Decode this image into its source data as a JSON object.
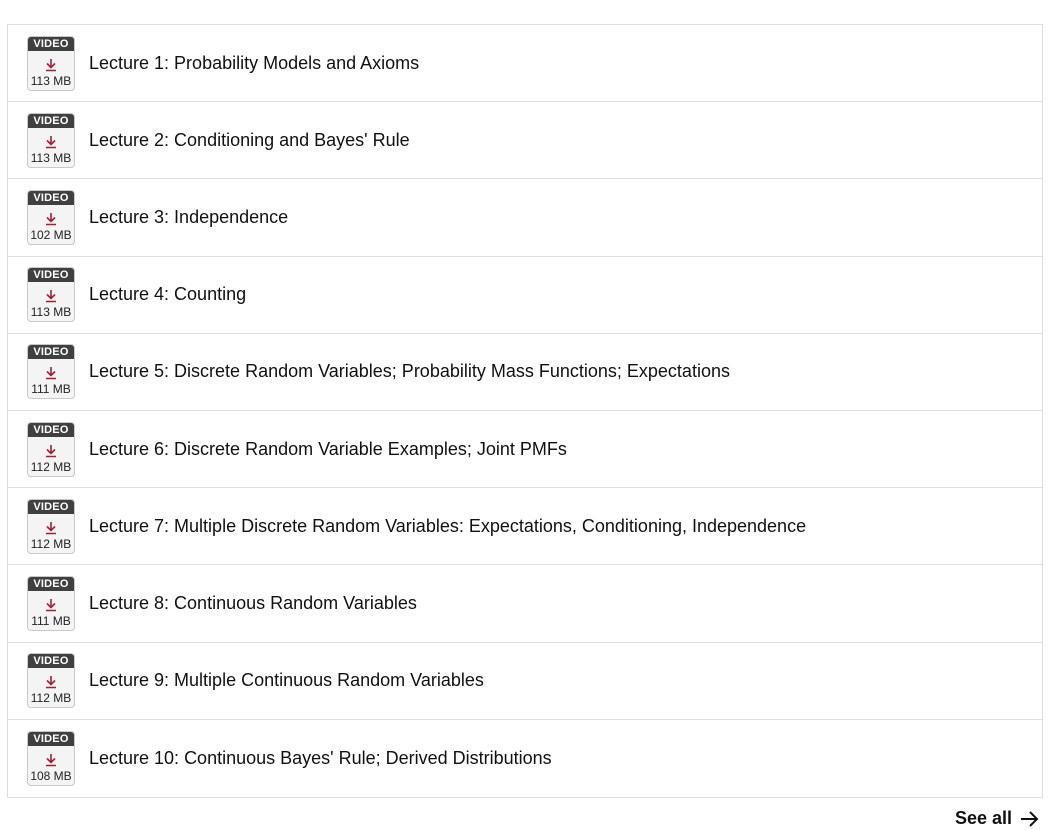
{
  "lectures": [
    {
      "badge": "VIDEO",
      "size": "113 MB",
      "title": "Lecture 1: Probability Models and Axioms"
    },
    {
      "badge": "VIDEO",
      "size": "113 MB",
      "title": "Lecture 2: Conditioning and Bayes' Rule"
    },
    {
      "badge": "VIDEO",
      "size": "102 MB",
      "title": "Lecture 3: Independence"
    },
    {
      "badge": "VIDEO",
      "size": "113 MB",
      "title": "Lecture 4: Counting"
    },
    {
      "badge": "VIDEO",
      "size": "111 MB",
      "title": "Lecture 5: Discrete Random Variables; Probability Mass Functions; Expectations"
    },
    {
      "badge": "VIDEO",
      "size": "112 MB",
      "title": "Lecture 6: Discrete Random Variable Examples; Joint PMFs"
    },
    {
      "badge": "VIDEO",
      "size": "112 MB",
      "title": "Lecture 7: Multiple Discrete Random Variables: Expectations, Conditioning, Independence"
    },
    {
      "badge": "VIDEO",
      "size": "111 MB",
      "title": "Lecture 8: Continuous Random Variables"
    },
    {
      "badge": "VIDEO",
      "size": "112 MB",
      "title": "Lecture 9: Multiple Continuous Random Variables"
    },
    {
      "badge": "VIDEO",
      "size": "108 MB",
      "title": "Lecture 10: Continuous Bayes' Rule; Derived Distributions"
    }
  ],
  "see_all": {
    "label": "See all",
    "icon": "arrow-right-icon"
  },
  "icons": {
    "download": "download-icon"
  },
  "colors": {
    "download_icon": "#a31f34",
    "badge_header": "#404040"
  }
}
